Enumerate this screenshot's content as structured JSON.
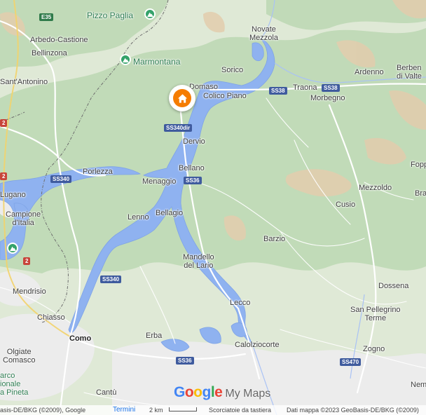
{
  "map": {
    "brand": {
      "google": "Google",
      "my_maps": "My Maps"
    },
    "colors": {
      "land": "#dfe9d6",
      "forest": "#b9d6b0",
      "water": "#8fb2f0",
      "mountain": "#e6cfb1",
      "urban": "#ececec",
      "road": "#ffffff",
      "border": "#6e6e6e",
      "marker": "#f57c00",
      "poi": "#34a26a"
    },
    "marker": {
      "icon": "home-icon"
    },
    "poi_markers": [
      {
        "name": "Pizzo Paglia",
        "icon": "mountain-icon"
      },
      {
        "name": "Marmontana",
        "icon": "mountain-icon"
      },
      {
        "name": "",
        "icon": "mountain-icon"
      }
    ],
    "labels": [
      "Pizzo Paglia",
      "Marmontana",
      "Novate\nMezzola",
      "Arbedo-Castione",
      "Bellinzona",
      "Sorico",
      "Ardenno",
      "Berben\ndi Valte",
      "Sant'Antonino",
      "Domaso",
      "Colico Piano",
      "Traona",
      "Morbegno",
      "Dervio",
      "Porlezza",
      "Bellano",
      "Lugano",
      "Menaggio",
      "Mezzoldo",
      "Fopp",
      "Bra",
      "Cusio",
      "Campione\nd'Italia",
      "Lenno",
      "Bellagio",
      "Barzio",
      "Mandello\ndel Lario",
      "Mendrisio",
      "Dossena",
      "Lecco",
      "San Pellegrino\nTerme",
      "Chiasso",
      "Como",
      "Erba",
      "Calolziocorte",
      "Zogno",
      "Olgiate\nComasco",
      "arco\nionale\na Pineta",
      "Cantù",
      "Nem"
    ],
    "route_shields": [
      "E35",
      "SS38",
      "SS38",
      "SS340dir",
      "SS340",
      "SS36",
      "SS340",
      "SS36",
      "SS470"
    ],
    "footer": {
      "attribution_left": "asis-DE/BKG (©2009), Google",
      "terms": "Termini",
      "scale": "2 km",
      "keyboard": "Scorciatoie da tastiera",
      "map_data": "Dati mappa ©2023 GeoBasis-DE/BKG (©2009)"
    }
  }
}
